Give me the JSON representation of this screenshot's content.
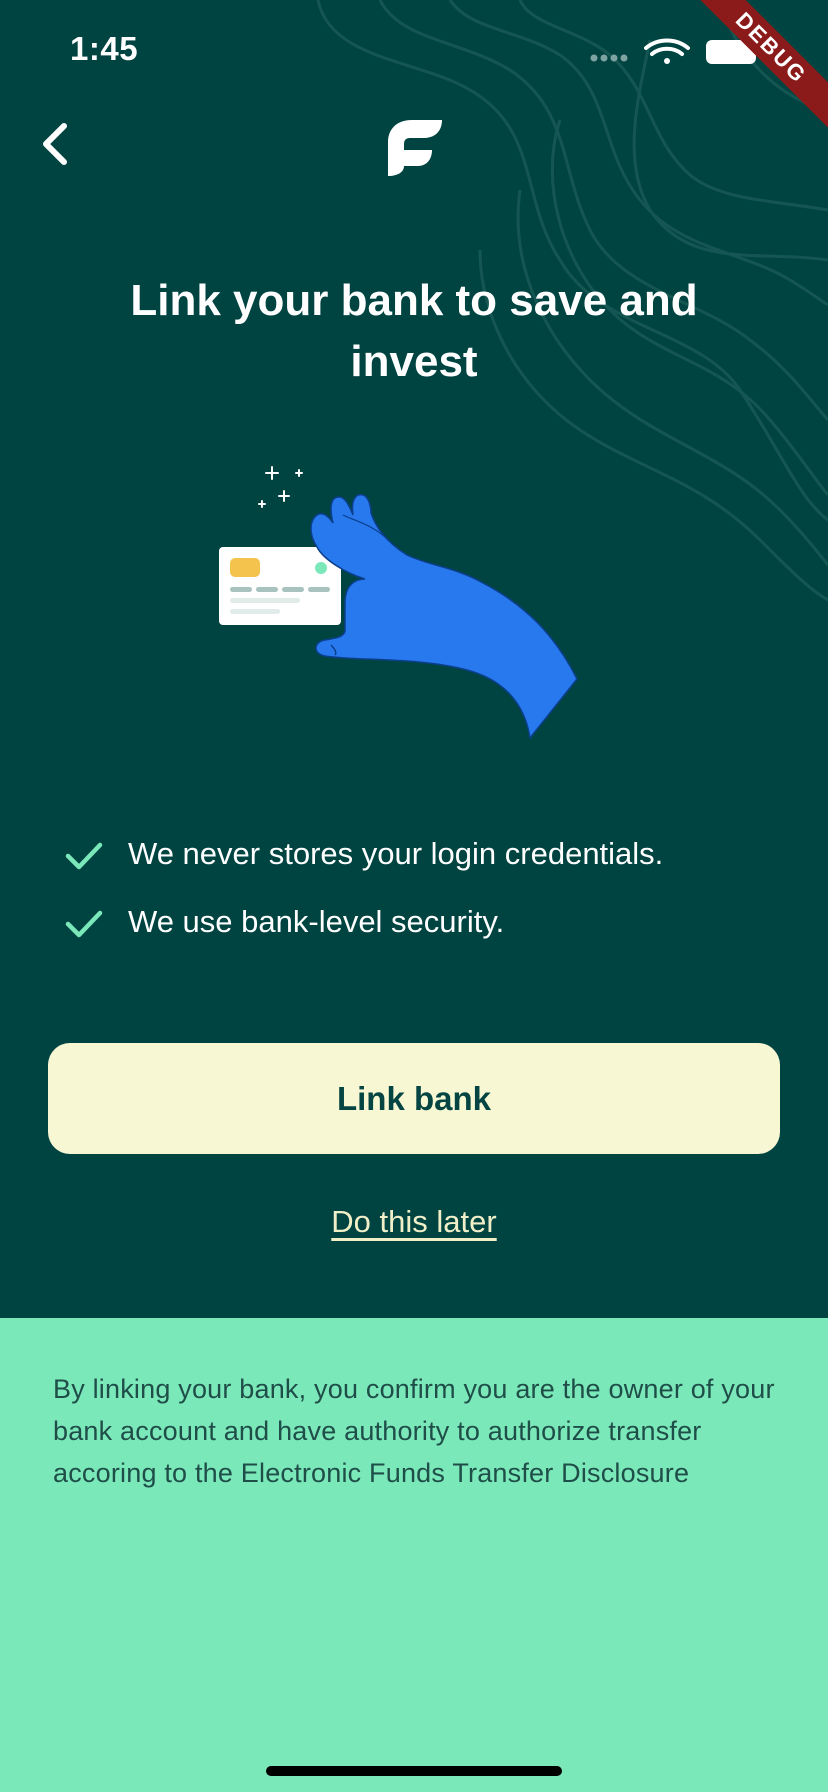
{
  "status_bar": {
    "time": "1:45",
    "icons": [
      "cellular-icon",
      "wifi-icon",
      "battery-icon"
    ]
  },
  "debug_banner": "DEBUG",
  "nav": {
    "back_icon": "chevron-left-icon",
    "logo_icon": "app-logo-icon"
  },
  "title": "Link your bank to save and invest",
  "illustration": "hand-holding-card-illustration",
  "features": [
    {
      "icon": "check-icon",
      "text": "We never stores your login credentials."
    },
    {
      "icon": "check-icon",
      "text": "We use bank-level security."
    }
  ],
  "actions": {
    "primary_label": "Link bank",
    "secondary_label": "Do this later"
  },
  "disclosure": "By linking your bank, you confirm you are the owner of your bank account and have authority to authorize transfer accoring to the Electronic Funds Transfer Disclosure",
  "colors": {
    "background_top": "#004442",
    "background_bottom": "#7BE8BA",
    "button_bg": "#F8F7D4",
    "accent_check": "#7BE8BA",
    "hand": "#2878EE"
  }
}
